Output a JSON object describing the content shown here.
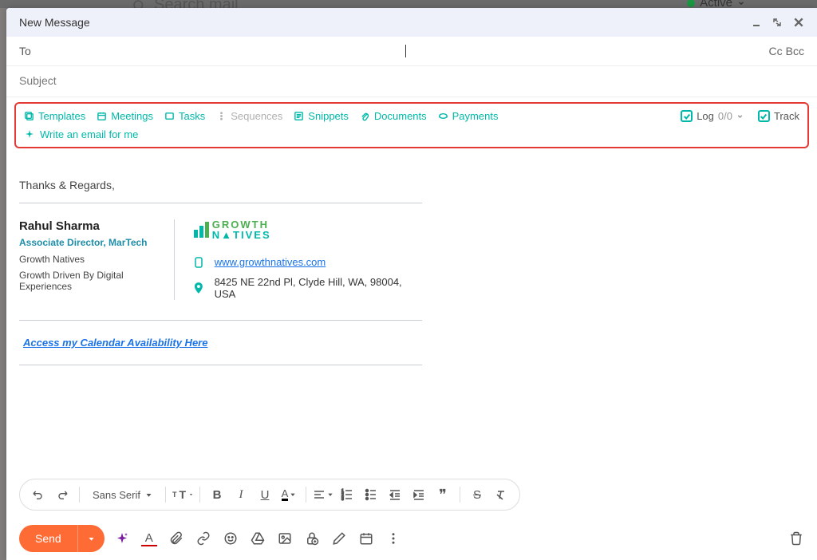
{
  "background": {
    "search_placeholder": "Search mail",
    "status": "Active"
  },
  "compose": {
    "title": "New Message",
    "to_label": "To",
    "cc": "Cc",
    "bcc": "Bcc",
    "subject_placeholder": "Subject"
  },
  "hubspot": {
    "templates": "Templates",
    "meetings": "Meetings",
    "tasks": "Tasks",
    "sequences": "Sequences",
    "snippets": "Snippets",
    "documents": "Documents",
    "payments": "Payments",
    "log_label": "Log",
    "log_count": "0/0",
    "track": "Track",
    "ai_write": "Write an email for me"
  },
  "body": {
    "closing": "Thanks & Regards,"
  },
  "signature": {
    "name": "Rahul Sharma",
    "title": "Associate Director, MarTech",
    "company": "Growth Natives",
    "tagline": "Growth Driven By Digital Experiences",
    "logo_growth": "GROWTH",
    "logo_natives": "N▲TIVES",
    "website": "www.growthnatives.com",
    "address": "8425 NE 22nd Pl, Clyde Hill, WA, 98004, USA",
    "calendar": "Access my Calendar Availability Here"
  },
  "format": {
    "font": "Sans Serif"
  },
  "send": {
    "label": "Send"
  }
}
